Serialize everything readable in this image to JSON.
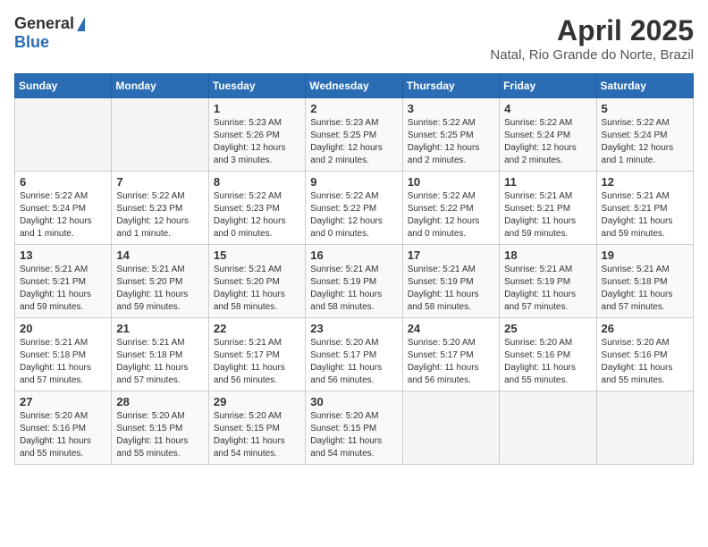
{
  "header": {
    "logo_general": "General",
    "logo_blue": "Blue",
    "month": "April 2025",
    "location": "Natal, Rio Grande do Norte, Brazil"
  },
  "weekdays": [
    "Sunday",
    "Monday",
    "Tuesday",
    "Wednesday",
    "Thursday",
    "Friday",
    "Saturday"
  ],
  "weeks": [
    [
      {
        "day": "",
        "info": ""
      },
      {
        "day": "",
        "info": ""
      },
      {
        "day": "1",
        "info": "Sunrise: 5:23 AM\nSunset: 5:26 PM\nDaylight: 12 hours and 3 minutes."
      },
      {
        "day": "2",
        "info": "Sunrise: 5:23 AM\nSunset: 5:25 PM\nDaylight: 12 hours and 2 minutes."
      },
      {
        "day": "3",
        "info": "Sunrise: 5:22 AM\nSunset: 5:25 PM\nDaylight: 12 hours and 2 minutes."
      },
      {
        "day": "4",
        "info": "Sunrise: 5:22 AM\nSunset: 5:24 PM\nDaylight: 12 hours and 2 minutes."
      },
      {
        "day": "5",
        "info": "Sunrise: 5:22 AM\nSunset: 5:24 PM\nDaylight: 12 hours and 1 minute."
      }
    ],
    [
      {
        "day": "6",
        "info": "Sunrise: 5:22 AM\nSunset: 5:24 PM\nDaylight: 12 hours and 1 minute."
      },
      {
        "day": "7",
        "info": "Sunrise: 5:22 AM\nSunset: 5:23 PM\nDaylight: 12 hours and 1 minute."
      },
      {
        "day": "8",
        "info": "Sunrise: 5:22 AM\nSunset: 5:23 PM\nDaylight: 12 hours and 0 minutes."
      },
      {
        "day": "9",
        "info": "Sunrise: 5:22 AM\nSunset: 5:22 PM\nDaylight: 12 hours and 0 minutes."
      },
      {
        "day": "10",
        "info": "Sunrise: 5:22 AM\nSunset: 5:22 PM\nDaylight: 12 hours and 0 minutes."
      },
      {
        "day": "11",
        "info": "Sunrise: 5:21 AM\nSunset: 5:21 PM\nDaylight: 11 hours and 59 minutes."
      },
      {
        "day": "12",
        "info": "Sunrise: 5:21 AM\nSunset: 5:21 PM\nDaylight: 11 hours and 59 minutes."
      }
    ],
    [
      {
        "day": "13",
        "info": "Sunrise: 5:21 AM\nSunset: 5:21 PM\nDaylight: 11 hours and 59 minutes."
      },
      {
        "day": "14",
        "info": "Sunrise: 5:21 AM\nSunset: 5:20 PM\nDaylight: 11 hours and 59 minutes."
      },
      {
        "day": "15",
        "info": "Sunrise: 5:21 AM\nSunset: 5:20 PM\nDaylight: 11 hours and 58 minutes."
      },
      {
        "day": "16",
        "info": "Sunrise: 5:21 AM\nSunset: 5:19 PM\nDaylight: 11 hours and 58 minutes."
      },
      {
        "day": "17",
        "info": "Sunrise: 5:21 AM\nSunset: 5:19 PM\nDaylight: 11 hours and 58 minutes."
      },
      {
        "day": "18",
        "info": "Sunrise: 5:21 AM\nSunset: 5:19 PM\nDaylight: 11 hours and 57 minutes."
      },
      {
        "day": "19",
        "info": "Sunrise: 5:21 AM\nSunset: 5:18 PM\nDaylight: 11 hours and 57 minutes."
      }
    ],
    [
      {
        "day": "20",
        "info": "Sunrise: 5:21 AM\nSunset: 5:18 PM\nDaylight: 11 hours and 57 minutes."
      },
      {
        "day": "21",
        "info": "Sunrise: 5:21 AM\nSunset: 5:18 PM\nDaylight: 11 hours and 57 minutes."
      },
      {
        "day": "22",
        "info": "Sunrise: 5:21 AM\nSunset: 5:17 PM\nDaylight: 11 hours and 56 minutes."
      },
      {
        "day": "23",
        "info": "Sunrise: 5:20 AM\nSunset: 5:17 PM\nDaylight: 11 hours and 56 minutes."
      },
      {
        "day": "24",
        "info": "Sunrise: 5:20 AM\nSunset: 5:17 PM\nDaylight: 11 hours and 56 minutes."
      },
      {
        "day": "25",
        "info": "Sunrise: 5:20 AM\nSunset: 5:16 PM\nDaylight: 11 hours and 55 minutes."
      },
      {
        "day": "26",
        "info": "Sunrise: 5:20 AM\nSunset: 5:16 PM\nDaylight: 11 hours and 55 minutes."
      }
    ],
    [
      {
        "day": "27",
        "info": "Sunrise: 5:20 AM\nSunset: 5:16 PM\nDaylight: 11 hours and 55 minutes."
      },
      {
        "day": "28",
        "info": "Sunrise: 5:20 AM\nSunset: 5:15 PM\nDaylight: 11 hours and 55 minutes."
      },
      {
        "day": "29",
        "info": "Sunrise: 5:20 AM\nSunset: 5:15 PM\nDaylight: 11 hours and 54 minutes."
      },
      {
        "day": "30",
        "info": "Sunrise: 5:20 AM\nSunset: 5:15 PM\nDaylight: 11 hours and 54 minutes."
      },
      {
        "day": "",
        "info": ""
      },
      {
        "day": "",
        "info": ""
      },
      {
        "day": "",
        "info": ""
      }
    ]
  ]
}
